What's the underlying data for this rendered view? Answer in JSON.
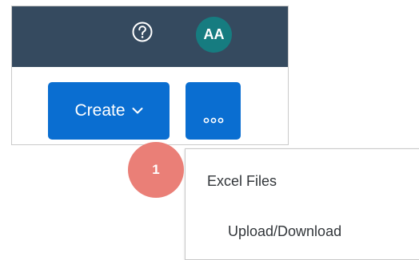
{
  "shellbar": {
    "background": "#354a5f",
    "help_icon": "question-mark-circle-icon",
    "avatar_initials": "AA",
    "avatar_color": "#167c80"
  },
  "toolbar": {
    "create_label": "Create",
    "create_icon": "chevron-down-icon",
    "overflow_icon": "more-dots-icon",
    "button_color": "#0a6ed1"
  },
  "menu": {
    "group_label": "Excel Files",
    "items": [
      {
        "label": "Upload/Download"
      }
    ]
  },
  "annotation": {
    "step_number": "1",
    "color": "#ea7f77"
  }
}
